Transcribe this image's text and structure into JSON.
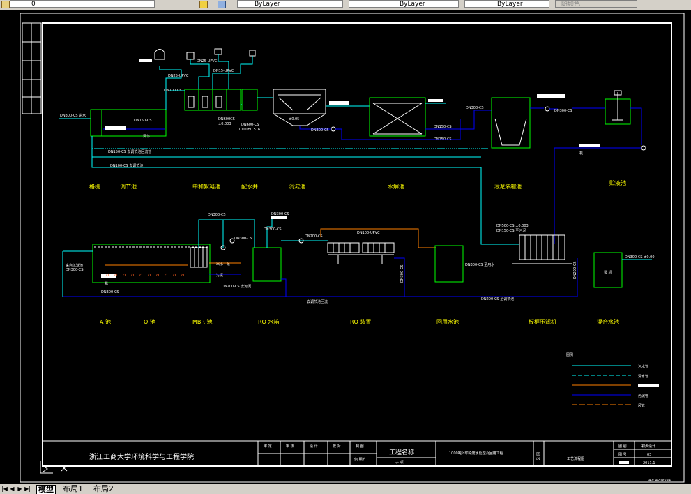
{
  "toolbar": {
    "layer_value": "0",
    "color_value": "ByLayer",
    "linetype_value": "ByLayer",
    "lineweight_value": "ByLayer",
    "plotstyle_value": "随颜色"
  },
  "drawing": {
    "top_unit_labels": [
      "格栅",
      "调节池",
      "中和絮凝池",
      "配水井",
      "沉淀池",
      "水解池",
      "污泥浓缩池",
      "贮液池"
    ],
    "bottom_unit_labels": [
      "A 池",
      "O 池",
      "MBR 池",
      "RO 水箱",
      "RO 装置",
      "回用水池",
      "板框压滤机",
      "混合水池"
    ],
    "pipe_labels": {
      "dn300_inflow": "DN300-CS 进水",
      "dn150_left": "DN150-CS",
      "dn150_return": "DN150-CS 去调节池回流管",
      "dn100_return": "DN100-CS 去调节池",
      "dn100_top": "DN100-CS",
      "dn25_upvc_1": "DN25-UPVC",
      "dn25_upvc_2": "DN25-UPVC",
      "dn15_upvc": "DN15-UPVC",
      "dn600_cs": "DN600CS",
      "elev_1": "±0.003",
      "dn600_cs_2": "DN600-CS",
      "dim_1000": "1000±0.516",
      "elev_2": "±0.05",
      "dn300_pump": "DN300-CS",
      "dn150_outlet": "DN150-CS",
      "dn150_return2": "DN150-CS",
      "dn300_right": "DN300-CS",
      "dn300_mid": "DN300-CS 至污泥",
      "dn300_upper": "DN300-CS",
      "dn300_lower": "DN300-CS",
      "dn200_cs": "DN200-CS",
      "dn300_cs_a": "DN300-CS",
      "dn300_cs_b": "DN300-CS",
      "dn300_bottom": "DN300-CS",
      "dn200_right": "DN200-CS",
      "dn100_upvc": "DN100-UPVC",
      "dn300_reuse": "DN300-CS 至用水",
      "dn150_sludge": "DN150-CS 至污泥",
      "dn300_ro": "DN300-CS 至 RO 水箱",
      "dn500_mix": "DN500-CS ±0.003",
      "dn300_mix": "DN300-CS ±0.00",
      "dn300_ao": "DN300-CS",
      "dn300_air": "DN300-CS",
      "mix_pump": "泵 机",
      "right_pump": "机",
      "ro_return": "去调节池回流",
      "reuse_note": "至用水池",
      "dn200_return": "DN200-CS 至调节池",
      "mbr_note1": "出水",
      "mbr_note2": "泵",
      "mbr_note3": "污泥",
      "tank_note": "调节",
      "bottom_left_note": "机",
      "a_pool_note1": "来自沉淀池",
      "a_pool_note2": "DN300-CS",
      "dn200_mbr": "DN200-CS 去污泥",
      "pump_mbr": "出水",
      "dn300_mbr_in": "DN300-CS",
      "mbr_dn300": "DN300-CS",
      "pump_note": "泵"
    },
    "legend": {
      "title": "图例",
      "items": [
        "污水管",
        "清水管",
        "",
        "污泥管",
        "风管"
      ]
    },
    "title_block": {
      "institution": "浙江工商大学环境科学与工程学院",
      "header_cells": [
        "审 定",
        "审 核",
        "设 计",
        "校 对",
        "制 图"
      ],
      "drafter": "何 明方",
      "project_label": "工程名称",
      "subproject_label": "子 项",
      "project_name": "1000吨/d印染废水处理及回用工程",
      "drawing_label": "图 名",
      "drawing_name": "工艺流程图",
      "category_label": "图 别",
      "category_value": "初步设计",
      "number_label": "图 号",
      "number_value": "03",
      "date_value": "2011.1",
      "sheet_size": "A2: 420x594"
    }
  },
  "layout_tabs": {
    "model": "模型",
    "layout1": "布局1",
    "layout2": "布局2"
  },
  "colors": {
    "background": "#000000",
    "frame": "#ffffff",
    "cyan_pipe": "#00ffff",
    "blue_pipe": "#0000ff",
    "orange_pipe": "#ff8000",
    "green_unit": "#00ff00",
    "yellow_label": "#ffff00",
    "red_aerator": "#ff4000"
  }
}
